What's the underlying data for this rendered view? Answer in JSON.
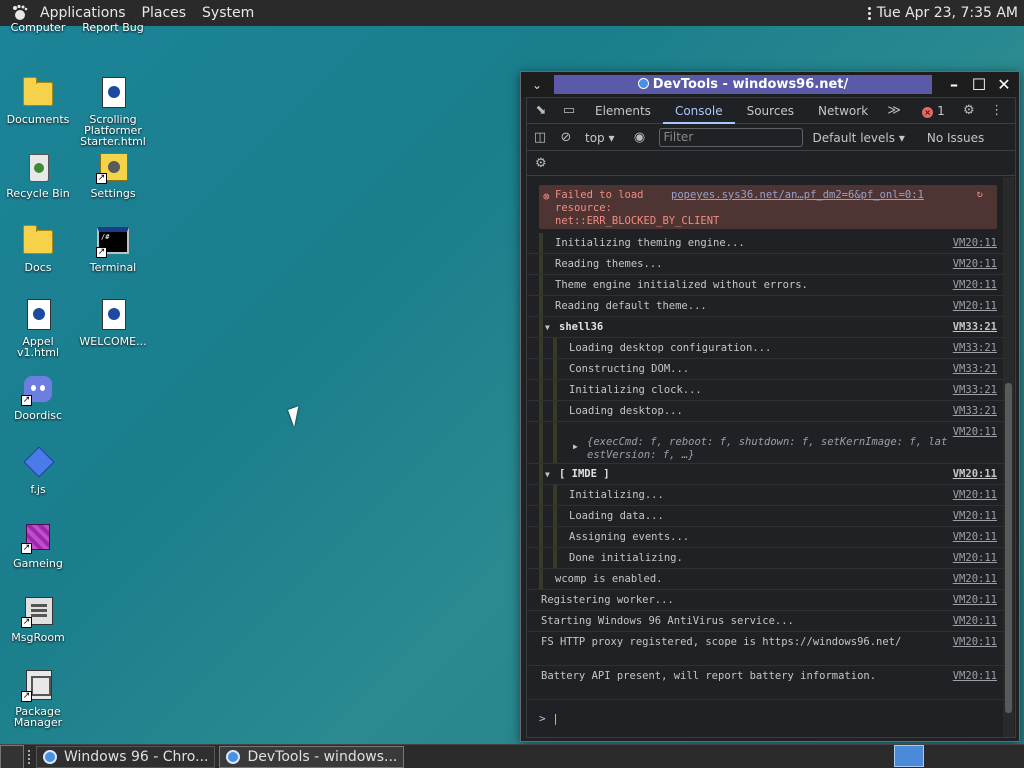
{
  "topbar": {
    "menus": [
      "Applications",
      "Places",
      "System"
    ],
    "clock": "Tue Apr 23,  7:35 AM"
  },
  "desktop": {
    "icons": [
      {
        "label": "Computer",
        "icon": "computer-icon"
      },
      {
        "label": "Report Bug",
        "icon": "report-bug-icon"
      },
      {
        "label": "Documents",
        "icon": "folder-icon"
      },
      {
        "label": "Scrolling Platformer Starter.html",
        "icon": "html-file-icon"
      },
      {
        "label": "Recycle Bin",
        "icon": "recycle-bin-icon"
      },
      {
        "label": "Settings",
        "icon": "settings-icon"
      },
      {
        "label": "Docs",
        "icon": "folder-icon"
      },
      {
        "label": "Terminal",
        "icon": "terminal-icon"
      },
      {
        "label": "Appel v1.html",
        "icon": "html-file-icon"
      },
      {
        "label": "WELCOME...",
        "icon": "markdown-file-icon"
      },
      {
        "label": "Doordisc",
        "icon": "discord-icon"
      },
      {
        "label": "f.js",
        "icon": "js-file-icon"
      },
      {
        "label": "Gameing",
        "icon": "cube-icon"
      },
      {
        "label": "MsgRoom",
        "icon": "msgroom-icon"
      },
      {
        "label": "Package Manager",
        "icon": "package-icon"
      }
    ],
    "terminal_glyph": "/#"
  },
  "devtools": {
    "window_title": "DevTools - windows96.net/",
    "tabs": [
      "Elements",
      "Console",
      "Sources",
      "Network"
    ],
    "active_tab": "Console",
    "more_tabs": "≫",
    "error_count": "1",
    "context": "top",
    "filter_placeholder": "Filter",
    "levels": "Default levels",
    "issues": "No Issues",
    "error": {
      "text": "Failed to load\nresource:\nnet::ERR_BLOCKED_BY_CLIENT",
      "source": "popeyes.sys36.net/an…pf_dm2=6&pf_onl=0:1"
    },
    "logs": [
      {
        "text": "Initializing theming engine...",
        "src": "VM20:11",
        "indent": 1
      },
      {
        "text": "Reading themes...",
        "src": "VM20:11",
        "indent": 1
      },
      {
        "text": "Theme engine initialized without errors.",
        "src": "VM20:11",
        "indent": 1
      },
      {
        "text": "Reading default theme...",
        "src": "VM20:11",
        "indent": 1
      },
      {
        "text": "shell36",
        "src": "VM33:21",
        "indent": 1,
        "group": true
      },
      {
        "text": "Loading desktop configuration...",
        "src": "VM33:21",
        "indent": 2
      },
      {
        "text": "Constructing DOM...",
        "src": "VM33:21",
        "indent": 2
      },
      {
        "text": "Initializing clock...",
        "src": "VM33:21",
        "indent": 2
      },
      {
        "text": "Loading desktop...",
        "src": "VM33:21",
        "indent": 2
      },
      {
        "text": "{execCmd: f, reboot: f, shutdown: f, setKernImage: f, lat estVersion: f, …}",
        "src": "VM20:11",
        "indent": 2,
        "object": true
      },
      {
        "text": "[ IMDE ]",
        "src": "VM20:11",
        "indent": 1,
        "group": true
      },
      {
        "text": "Initializing...",
        "src": "VM20:11",
        "indent": 2
      },
      {
        "text": "Loading data...",
        "src": "VM20:11",
        "indent": 2
      },
      {
        "text": "Assigning events...",
        "src": "VM20:11",
        "indent": 2
      },
      {
        "text": "Done initializing.",
        "src": "VM20:11",
        "indent": 2
      },
      {
        "text": "wcomp is enabled.",
        "src": "VM20:11",
        "indent": 1
      },
      {
        "text": "Registering worker...",
        "src": "VM20:11",
        "indent": 0
      },
      {
        "text": "Starting Windows 96 AntiVirus service...",
        "src": "VM20:11",
        "indent": 0
      },
      {
        "text": "FS HTTP proxy registered, scope is https://windows96.net/",
        "src": "VM20:11",
        "indent": 0
      },
      {
        "text": "Battery API present, will report battery information.",
        "src": "VM20:11",
        "indent": 0
      }
    ],
    "prompt": ">"
  },
  "taskbar": {
    "items": [
      "Windows 96 - Chro...",
      "DevTools - windows..."
    ]
  },
  "colors": {
    "accent": "#a8c7fa",
    "error": "#f28b82",
    "title_bar": "#5a5aa8"
  }
}
